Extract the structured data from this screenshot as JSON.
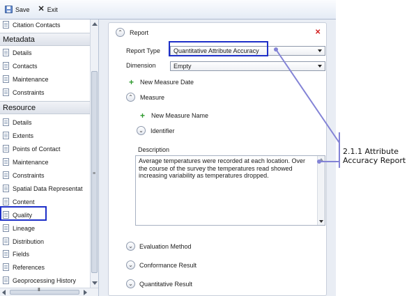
{
  "toolbar": {
    "save_label": "Save",
    "exit_label": "Exit"
  },
  "sidebar": {
    "top_items": [
      {
        "label": "Citation Contacts"
      }
    ],
    "metadata_header": "Metadata",
    "metadata_items": [
      {
        "label": "Details"
      },
      {
        "label": "Contacts"
      },
      {
        "label": "Maintenance"
      },
      {
        "label": "Constraints"
      }
    ],
    "resource_header": "Resource",
    "resource_items": [
      {
        "label": "Details"
      },
      {
        "label": "Extents"
      },
      {
        "label": "Points of Contact"
      },
      {
        "label": "Maintenance"
      },
      {
        "label": "Constraints"
      },
      {
        "label": "Spatial Data Representat"
      },
      {
        "label": "Content"
      },
      {
        "label": "Quality"
      },
      {
        "label": "Lineage"
      },
      {
        "label": "Distribution"
      },
      {
        "label": "Fields"
      },
      {
        "label": "References"
      },
      {
        "label": "Geoprocessing History"
      }
    ]
  },
  "report": {
    "title": "Report",
    "report_type_label": "Report Type",
    "report_type_value": "Quantitative Attribute Accuracy",
    "dimension_label": "Dimension",
    "dimension_value": "Empty",
    "new_measure_date": "New Measure Date",
    "measure_title": "Measure",
    "new_measure_name": "New Measure Name",
    "identifier_title": "Identifier",
    "description_label": "Description",
    "description_text": "Average temperatures were recorded at each location. Over the course of the survey the temperatures read showed increasing variability as temperatures dropped.",
    "evaluation_method": "Evaluation Method",
    "conformance_result": "Conformance Result",
    "quantitative_result": "Quantitative Result"
  },
  "callout": {
    "line1": "2.1.1 Attribute",
    "line2": "Accuracy Report"
  },
  "colors": {
    "highlight": "#1d2fc8",
    "callout_line": "#8383d6",
    "add_green": "#2e9a2e",
    "close_red": "#d21c1c"
  }
}
